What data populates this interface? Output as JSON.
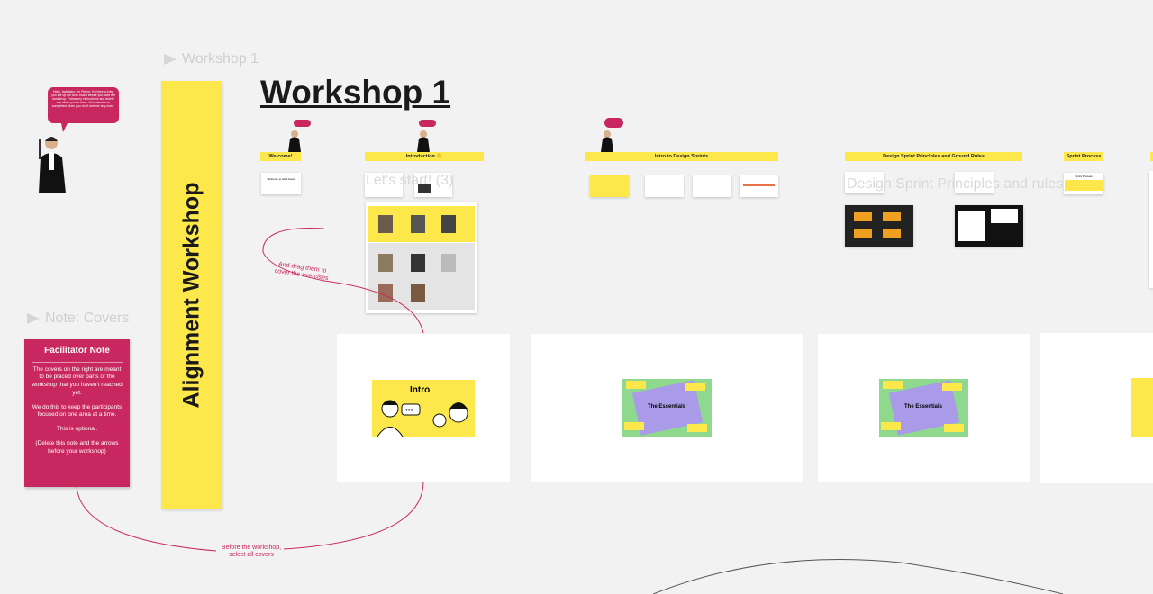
{
  "frame_labels": {
    "workshop": "Workshop 1",
    "note": "Note: Covers"
  },
  "title": "Workshop 1",
  "vertical_banner": "Alignment Workshop",
  "bot_bubble": "Hello, facilitator. I'm Pierce. I'm here to help you set up the Miro board before you start the workshop. Follow my instructions and delete me when you're done. Your mission is completed when you don't see me any more.",
  "facilitator_note": {
    "title": "Facilitator Note",
    "paragraphs": [
      "The covers on the right are meant to be placed over parts of the workshop that you haven't reached yet.",
      "We do this to keep the participants focused on one area at a time.",
      "This is optional.",
      "(Delete this note and the arrows before your workshop)"
    ]
  },
  "sections": [
    {
      "label": "Welcome!"
    },
    {
      "label": "Introduction 👋"
    },
    {
      "label": "Intro to Design Sprints"
    },
    {
      "label": "Design Sprint Principles and Ground Rules"
    },
    {
      "label": "Sprint Process"
    }
  ],
  "thumbs": {
    "welcome": "Welcome to A&B board",
    "sprint_process": "Sprint Process"
  },
  "ghost_text": {
    "lets_start": "Let's start! (3)",
    "principles": "Design Sprint Principles and rules"
  },
  "annotations": {
    "drag": "And drag them to cover the exercises",
    "select": "Before the workshop, select all covers"
  },
  "covers": [
    {
      "label": "Intro"
    },
    {
      "label": "The Essentials"
    },
    {
      "label": "The Essentials"
    }
  ],
  "colors": {
    "accent_pink": "#c8285f",
    "yellow": "#fce84a",
    "background": "#f2f2f2",
    "lavender": "#a99be8"
  }
}
